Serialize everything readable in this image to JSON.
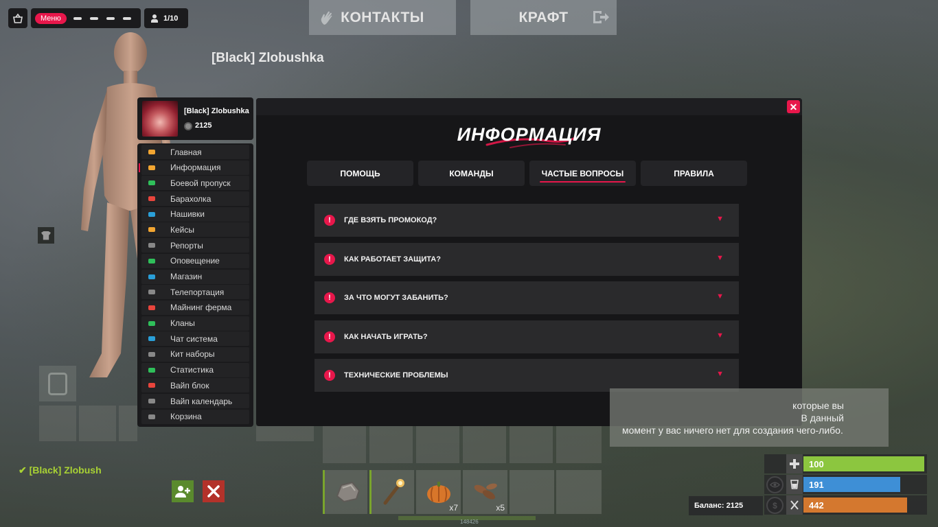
{
  "hud": {
    "menu_label": "Меню",
    "players_label": "1/10",
    "icons": [
      "basket-icon",
      "plane-icon",
      "helicopter-icon",
      "tank-icon",
      "boat-icon",
      "person-icon"
    ]
  },
  "top_tabs": {
    "contacts": "КОНТАКТЫ",
    "craft": "КРАФТ"
  },
  "player_title": "[Black] Zlobushka",
  "profile": {
    "name": "[Black] Zlobushka",
    "balance": "2125"
  },
  "sidebar": {
    "items": [
      {
        "label": "Главная",
        "color": "#f2a531"
      },
      {
        "label": "Информация",
        "color": "#f2a531"
      },
      {
        "label": "Боевой пропуск",
        "color": "#2fbf5a"
      },
      {
        "label": "Барахолка",
        "color": "#e8453c"
      },
      {
        "label": "Нашивки",
        "color": "#2a9fd8"
      },
      {
        "label": "Кейсы",
        "color": "#f2a531"
      },
      {
        "label": "Репорты",
        "color": "#888888"
      },
      {
        "label": "Оповещение",
        "color": "#2fbf5a"
      },
      {
        "label": "Магазин",
        "color": "#2a9fd8"
      },
      {
        "label": "Телепортация",
        "color": "#888888"
      },
      {
        "label": "Майнинг ферма",
        "color": "#e8453c"
      },
      {
        "label": "Кланы",
        "color": "#2fbf5a"
      },
      {
        "label": "Чат система",
        "color": "#2a9fd8"
      },
      {
        "label": "Кит наборы",
        "color": "#888888"
      },
      {
        "label": "Статистика",
        "color": "#2fbf5a"
      },
      {
        "label": "Вайп блок",
        "color": "#e8453c"
      },
      {
        "label": "Вайп календарь",
        "color": "#888888"
      },
      {
        "label": "Корзина",
        "color": "#888888"
      }
    ],
    "active_index": 1
  },
  "modal": {
    "title": "ИНФОРМАЦИЯ",
    "tabs": [
      "ПОМОЩЬ",
      "КОМАНДЫ",
      "ЧАСТЫЕ ВОПРОСЫ",
      "ПРАВИЛА"
    ],
    "active_tab": 2,
    "faq": [
      "ГДЕ ВЗЯТЬ ПРОМОКОД?",
      "КАК РАБОТАЕТ ЗАЩИТА?",
      "ЗА ЧТО МОГУТ ЗАБАНИТЬ?",
      "КАК НАЧАТЬ ИГРАТЬ?",
      "ТЕХНИЧЕСКИЕ ПРОБЛЕМЫ"
    ],
    "faq_icon": "!",
    "faq_arrow": "▼",
    "close_glyph": "✕"
  },
  "craft_info": {
    "line1": "которые вы",
    "line2": "В данный",
    "line3": "момент у вас ничего нет для создания чего-либо."
  },
  "team": {
    "member": "✔ [Black] Zlobush"
  },
  "hotbar": {
    "qty_pumpkin": "x7",
    "qty_seeds": "x5",
    "below_number": "148426"
  },
  "stats": {
    "health": {
      "value": "100",
      "fraction": 1.0,
      "color": "#8cc63f"
    },
    "water": {
      "value": "191",
      "fraction": 0.8,
      "color": "#3e8fd6"
    },
    "food": {
      "value": "442",
      "fraction": 0.86,
      "color": "#d4782f"
    },
    "balance_label": "Баланс: 2125"
  },
  "accent_color": "#e8174b"
}
